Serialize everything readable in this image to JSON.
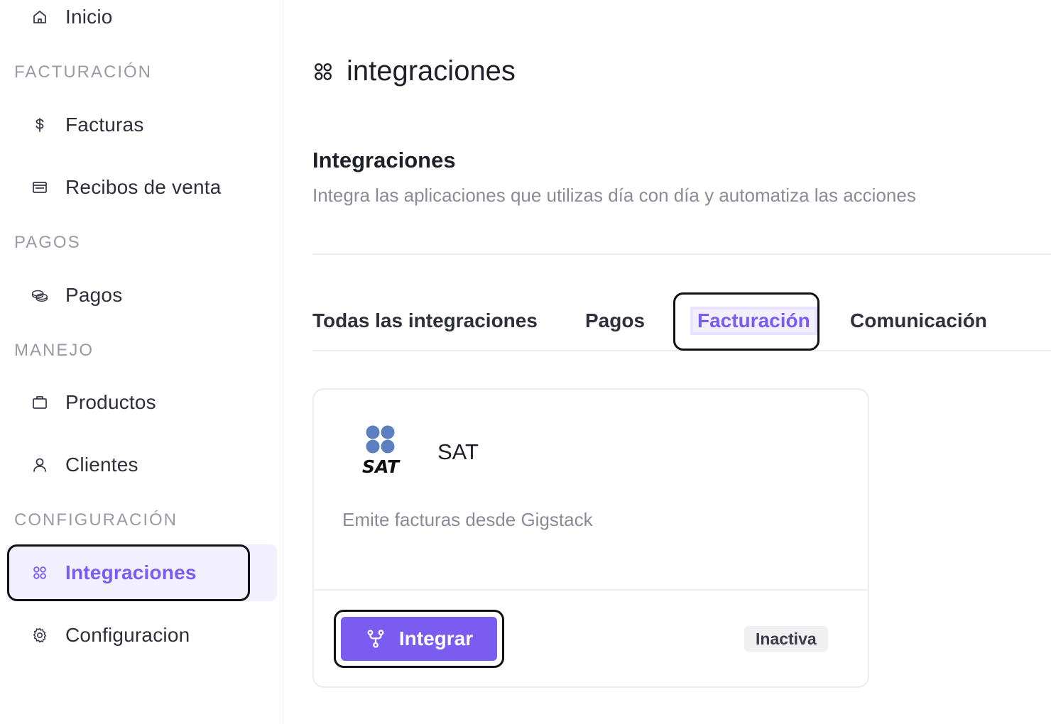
{
  "sidebar": {
    "items": [
      {
        "label": "Inicio",
        "icon": "home-icon"
      },
      {
        "label": "Facturas",
        "icon": "dollar-icon"
      },
      {
        "label": "Recibos de venta",
        "icon": "receipt-icon"
      },
      {
        "label": "Pagos",
        "icon": "coins-icon"
      },
      {
        "label": "Productos",
        "icon": "box-icon"
      },
      {
        "label": "Clientes",
        "icon": "user-icon"
      },
      {
        "label": "Integraciones",
        "icon": "apps-icon",
        "active": true
      },
      {
        "label": "Configuracion",
        "icon": "gear-icon"
      }
    ],
    "sections": [
      "FACTURACIÓN",
      "PAGOS",
      "MANEJO",
      "CONFIGURACIÓN"
    ]
  },
  "main": {
    "page_title": "integraciones",
    "heading": "Integraciones",
    "subtitle": "Integra las aplicaciones que utilizas día con día y automatiza las acciones",
    "tabs": [
      {
        "label": "Todas las integraciones"
      },
      {
        "label": "Pagos"
      },
      {
        "label": "Facturación",
        "active": true
      },
      {
        "label": "Comunicación"
      }
    ],
    "card": {
      "logo_text": "SAT",
      "name": "SAT",
      "description": "Emite facturas desde Gigstack",
      "button_label": "Integrar",
      "status": "Inactiva"
    }
  },
  "colors": {
    "accent": "#7b5cf0",
    "accent_bg": "#f2efff",
    "logo_blue": "#5b7fc0"
  }
}
